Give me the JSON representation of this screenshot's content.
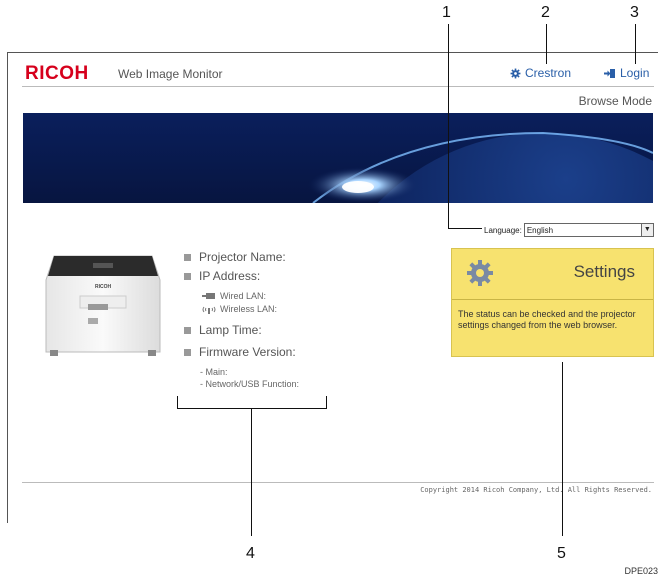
{
  "header": {
    "logo": "RICOH",
    "app_title": "Web Image Monitor",
    "crestron_label": "Crestron",
    "login_label": "Login",
    "mode": "Browse Mode"
  },
  "language": {
    "label": "Language:",
    "value": "English"
  },
  "device_info": {
    "projector_name": "Projector Name:",
    "ip_address": "IP Address:",
    "wired_lan": "Wired LAN:",
    "wireless_lan": "Wireless LAN:",
    "lamp_time": "Lamp Time:",
    "firmware_version": "Firmware Version:",
    "main": "- Main:",
    "network_usb": "- Network/USB Function:"
  },
  "projector_image": {
    "brand_label": "RICOH"
  },
  "settings_card": {
    "label": "Settings",
    "description": "The status can be checked and the projector settings changed from the web browser."
  },
  "footer": {
    "copyright": "Copyright 2014 Ricoh Company, Ltd. All Rights Reserved."
  },
  "callouts": [
    "1",
    "2",
    "3",
    "4",
    "5"
  ],
  "figure_id": "DPE023",
  "colors": {
    "brand": "#d6001c",
    "link": "#2a5fa8",
    "settings_bg": "#f7e26f"
  },
  "icons": [
    "gear-icon",
    "login-icon",
    "wired-lan-icon",
    "wireless-lan-icon",
    "dropdown-arrow-icon"
  ]
}
